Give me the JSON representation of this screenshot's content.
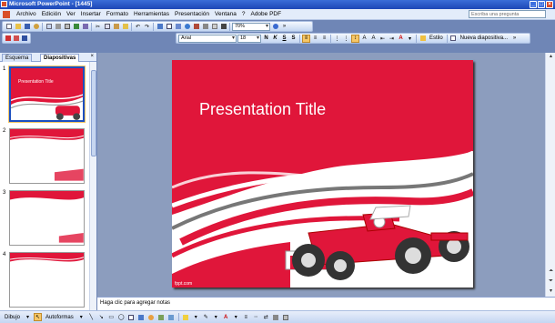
{
  "window": {
    "title": "Microsoft PowerPoint - [1445]"
  },
  "menu": {
    "items": [
      "Archivo",
      "Edición",
      "Ver",
      "Insertar",
      "Formato",
      "Herramientas",
      "Presentación",
      "Ventana",
      "?",
      "Adobe PDF"
    ]
  },
  "help_box": {
    "placeholder": "Escriba una pregunta"
  },
  "standard_toolbar": {
    "zoom": "70%"
  },
  "format_toolbar": {
    "font": "Arial",
    "size": "18",
    "bold": "N",
    "italic": "K",
    "underline": "S",
    "shadow": "S",
    "design_label": "Estilo",
    "new_slide_label": "Nueva diapositiva..."
  },
  "panel": {
    "tabs": [
      "Esquema",
      "Diapositivas"
    ],
    "slides": [
      "1",
      "2",
      "3",
      "4"
    ],
    "thumb_title": "Presentation Title"
  },
  "slide": {
    "title": "Presentation Title",
    "footer": "fppt.com"
  },
  "notes": {
    "placeholder": "Haga clic para agregar notas"
  },
  "drawing_toolbar": {
    "draw_label": "Dibujo",
    "autoshapes_label": "Autoformas"
  },
  "colors": {
    "slide_red": "#e0163a",
    "accent_selection": "#f7c766",
    "title_bar": "#1c47b6"
  }
}
